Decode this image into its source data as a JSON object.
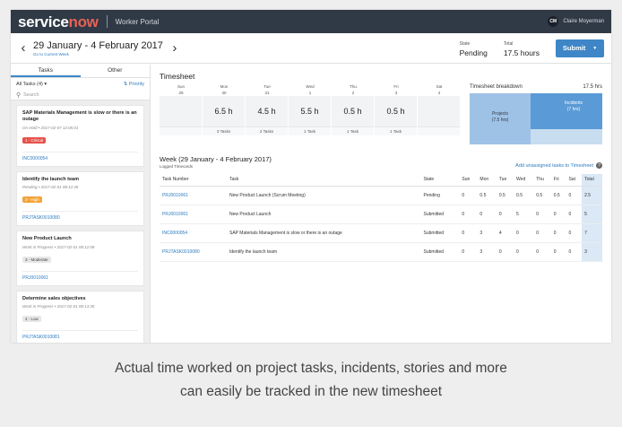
{
  "nav": {
    "logo_dark": "service",
    "logo_accent": "now",
    "portal": "Worker Portal",
    "user_initials": "CM",
    "user_name": "Claire Moyerman"
  },
  "week": {
    "title": "29 January - 4 February 2017",
    "current_link": "Go to Current Week",
    "state_label": "State",
    "state_value": "Pending",
    "total_label": "Total",
    "total_value": "17.5 hours",
    "submit_label": "Submit"
  },
  "left": {
    "tabs": [
      "Tasks",
      "Other"
    ],
    "filter_label": "All Tasks (4) ▾",
    "priority_label": "Priority",
    "search_placeholder": "Search",
    "cards": [
      {
        "title": "SAP Materials Management is slow or there is an outage",
        "status": "On Hold • 2017-02-07 12:05:01",
        "badge": "1 - Critical",
        "number": "INC0000054"
      },
      {
        "title": "Identify the launch team",
        "status": "Pending • 2017-02-01 08:12:45",
        "badge": "2 - High",
        "number": "PRJTASK0010080"
      },
      {
        "title": "New Product Launch",
        "status": "Work in Progress • 2017-02-01 08:12:08",
        "badge": "3 - Moderate",
        "number": "PRJ0010061"
      },
      {
        "title": "Determine sales objectives",
        "status": "Work in Progress • 2017-02-01 08:13:35",
        "badge": "4 - Low",
        "number": "PRJTASK0010081"
      }
    ]
  },
  "timesheet": {
    "title": "Timesheet",
    "days": [
      {
        "name": "Sun",
        "num": "29",
        "hours": "",
        "tasks": ""
      },
      {
        "name": "Mon",
        "num": "30",
        "hours": "6.5 h",
        "tasks": "3 Tasks"
      },
      {
        "name": "Tue",
        "num": "31",
        "hours": "4.5 h",
        "tasks": "2 Tasks"
      },
      {
        "name": "Wed",
        "num": "1",
        "hours": "5.5 h",
        "tasks": "1 Task"
      },
      {
        "name": "Thu",
        "num": "2",
        "hours": "0.5 h",
        "tasks": "1 Task"
      },
      {
        "name": "Fri",
        "num": "3",
        "hours": "0.5 h",
        "tasks": "1 Task"
      },
      {
        "name": "Sat",
        "num": "4",
        "hours": "",
        "tasks": ""
      }
    ],
    "breakdown": {
      "title": "Timesheet breakdown",
      "total": "17.5 hrs",
      "projects_label": "Projects",
      "projects_value": "(7.5 hrs)",
      "incidents_label": "Incidents",
      "incidents_value": "(7 hrs)"
    }
  },
  "week_table": {
    "title": "Week (29 January - 4 February 2017)",
    "subtitle": "Logged Timecards",
    "add_link": "Add unassigned tasks to Timesheet",
    "columns": [
      "Task Number",
      "Task",
      "State",
      "Sun",
      "Mon",
      "Tue",
      "Wed",
      "Thu",
      "Fri",
      "Sat",
      "Total"
    ],
    "rows": [
      [
        "PRJ0010061",
        "New Product Launch (Scrum Meeting)",
        "Pending",
        "0",
        "0.5",
        "0.5",
        "0.5",
        "0.5",
        "0.5",
        "0",
        "2.5"
      ],
      [
        "PRJ0010061",
        "New Product Launch",
        "Submitted",
        "0",
        "0",
        "0",
        "5",
        "0",
        "0",
        "0",
        "5"
      ],
      [
        "INC0000054",
        "SAP Materials Management is slow or there is an outage",
        "Submitted",
        "0",
        "3",
        "4",
        "0",
        "0",
        "0",
        "0",
        "7"
      ],
      [
        "PRJTASK0010080",
        "Identify the launch team",
        "Submitted",
        "0",
        "3",
        "0",
        "0",
        "0",
        "0",
        "0",
        "3"
      ]
    ]
  },
  "caption": {
    "line1": "Actual time worked on project tasks, incidents, stories and more",
    "line2": "can easily be tracked in the new timesheet"
  },
  "colors": {
    "topbar": "#303a46",
    "accent_logo": "#e96155",
    "primary": "#3e86c7",
    "link": "#2e7bbf",
    "critical": "#e5534b",
    "high": "#f2a43a"
  }
}
